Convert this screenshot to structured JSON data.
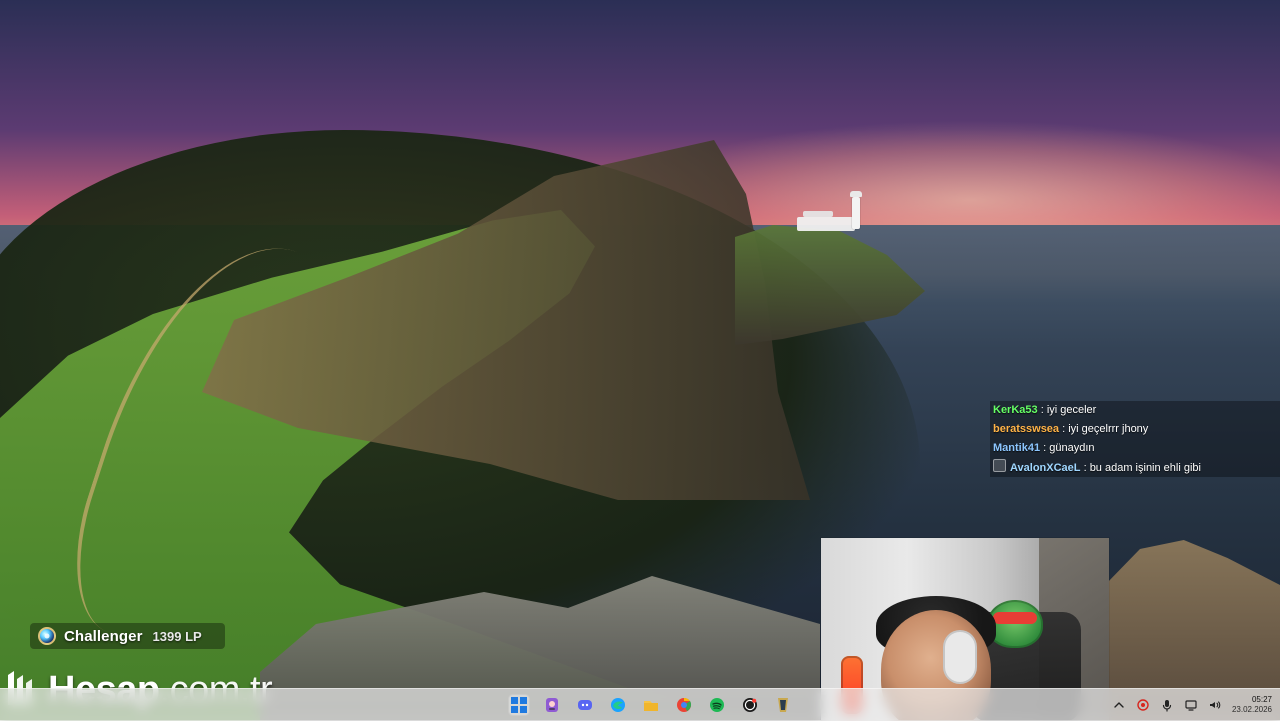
{
  "chat": {
    "messages": [
      {
        "user": "KerKa53",
        "message": "iyi geceler",
        "color": "#66ff66",
        "has_icon": false
      },
      {
        "user": "beratsswsea",
        "message": "iyi geçelrrr jhony",
        "color": "#ffb347",
        "has_icon": false
      },
      {
        "user": "Mantik41",
        "message": "günaydın",
        "color": "#8cc6ff",
        "has_icon": false
      },
      {
        "user": "AvalonXCaeL",
        "message": "bu adam işinin ehli gibi",
        "color": "#9fd6ff",
        "has_icon": true
      }
    ],
    "separator": " : "
  },
  "rank": {
    "name": "Challenger",
    "lp": "1399 LP",
    "icon": "challenger-rank-icon"
  },
  "watermark": {
    "main": "Hesap",
    "suffix": ".com.tr"
  },
  "taskbar": {
    "pinned_icons": [
      {
        "name": "windows-start-icon"
      },
      {
        "name": "game-app-icon"
      },
      {
        "name": "discord-icon"
      },
      {
        "name": "edge-icon"
      },
      {
        "name": "file-explorer-icon"
      },
      {
        "name": "chrome-icon"
      },
      {
        "name": "spotify-icon"
      },
      {
        "name": "obs-icon"
      },
      {
        "name": "league-icon"
      }
    ],
    "tray_icons": [
      {
        "name": "tray-chevron-up-icon"
      },
      {
        "name": "tray-recording-icon"
      },
      {
        "name": "tray-mic-icon"
      },
      {
        "name": "tray-network-icon"
      },
      {
        "name": "tray-volume-icon"
      }
    ],
    "clock": {
      "time": "05:27",
      "date": "23.02.2026"
    }
  }
}
